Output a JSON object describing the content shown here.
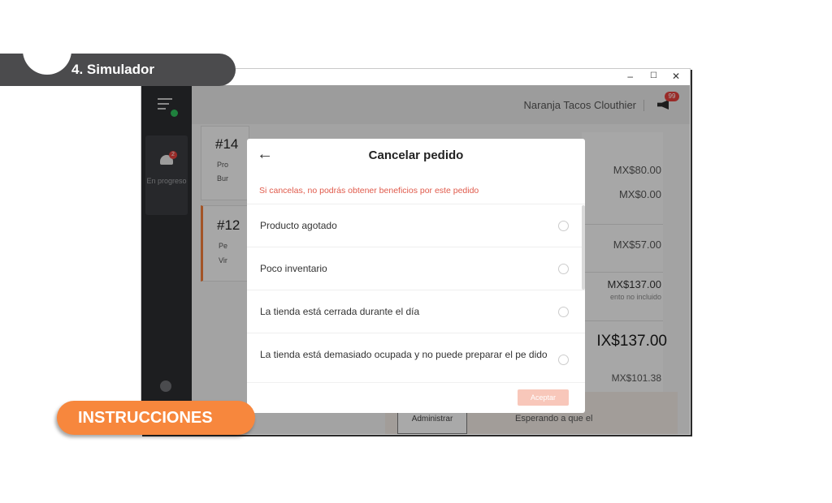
{
  "slide": {
    "section_tag": "4. Simulador",
    "instructions_button": "INSTRUCCIONES"
  },
  "window": {
    "controls": {
      "minimize": "–",
      "maximize": "☐",
      "close": "✕"
    }
  },
  "sidebar": {
    "nav_item_label": "En progreso",
    "nav_item_badge": "2"
  },
  "header": {
    "store_name": "Naranja Tacos Clouthier",
    "notification_count": "99"
  },
  "orders": [
    {
      "number": "#14",
      "line1": "Pro",
      "line2": "Bur"
    },
    {
      "number": "#12",
      "line1": "Pe",
      "line2": "Vir"
    }
  ],
  "right_panel": {
    "prices": [
      "MX$80.00",
      "MX$0.00",
      "MX$57.00",
      "MX$137.00"
    ],
    "note": "ento no incluido",
    "total": "IX$137.00",
    "partial": "MX$101.38"
  },
  "bottom": {
    "admin_button": "Administrar",
    "status": "Esperando a que el"
  },
  "modal": {
    "title": "Cancelar pedido",
    "back_icon": "←",
    "warning": "Si cancelas, no podrás obtener beneficios por este pedido",
    "options": [
      "Producto agotado",
      "Poco inventario",
      "La tienda está cerrada durante el día",
      "La tienda está demasiado ocupada y no puede preparar el pe dido"
    ],
    "accept_button": "Aceptar"
  },
  "colors": {
    "tag_bg": "#4b4b4d",
    "instructions_bg": "#f7873d",
    "warning_text": "#e05a4b",
    "accept_bg": "#f8c7ba",
    "sidebar_bg": "#2b2d30"
  }
}
